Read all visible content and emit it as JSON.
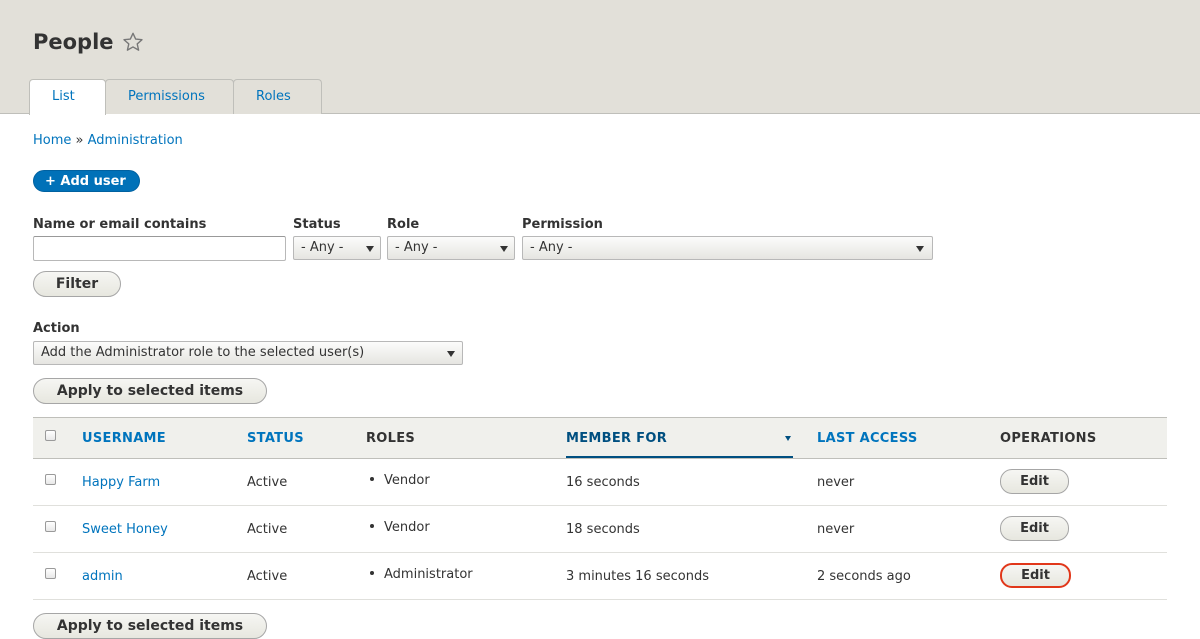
{
  "header": {
    "title": "People",
    "tabs": [
      {
        "label": "List",
        "active": true
      },
      {
        "label": "Permissions",
        "active": false
      },
      {
        "label": "Roles",
        "active": false
      }
    ]
  },
  "breadcrumb": {
    "home": "Home",
    "separator": "»",
    "current": "Administration"
  },
  "add_user_label": "+ Add user",
  "filters": {
    "name_label": "Name or email contains",
    "name_value": "",
    "status_label": "Status",
    "status_value": "- Any -",
    "role_label": "Role",
    "role_value": "- Any -",
    "permission_label": "Permission",
    "permission_value": "- Any -",
    "filter_button": "Filter"
  },
  "action": {
    "label": "Action",
    "value": "Add the Administrator role to the selected user(s)",
    "apply_button": "Apply to selected items"
  },
  "table": {
    "columns": [
      "USERNAME",
      "STATUS",
      "ROLES",
      "MEMBER FOR",
      "LAST ACCESS",
      "OPERATIONS"
    ],
    "rows": [
      {
        "username": "Happy Farm",
        "status": "Active",
        "role": "Vendor",
        "member_for": "16 seconds",
        "last_access": "never",
        "operation": "Edit"
      },
      {
        "username": "Sweet Honey",
        "status": "Active",
        "role": "Vendor",
        "member_for": "18 seconds",
        "last_access": "never",
        "operation": "Edit"
      },
      {
        "username": "admin",
        "status": "Active",
        "role": "Administrator",
        "member_for": "3 minutes 16 seconds",
        "last_access": "2 seconds ago",
        "operation": "Edit"
      }
    ]
  },
  "bottom_apply_button": "Apply to selected items",
  "colors": {
    "link": "#0074bd",
    "primary_button": "#0071b8",
    "focus_ring": "#e1371a",
    "header_bg": "#e2e0d9"
  }
}
